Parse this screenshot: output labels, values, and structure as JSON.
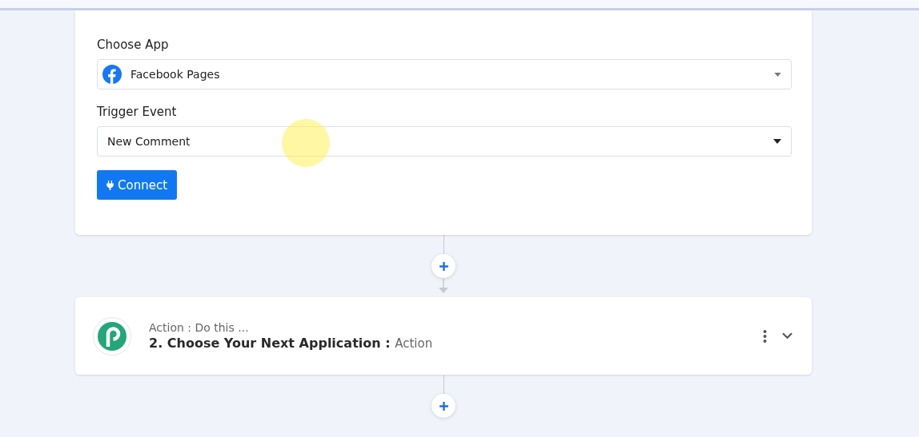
{
  "trigger_card": {
    "fields": [
      {
        "label": "Choose App",
        "value": "Facebook Pages",
        "kind": "app"
      },
      {
        "label": "Trigger Event",
        "value": "New Comment",
        "kind": "plain"
      }
    ],
    "connect_button": "Connect"
  },
  "action_card": {
    "subtitle": "Action : Do this ...",
    "title": "2. Choose Your Next Application :",
    "type": "Action"
  }
}
